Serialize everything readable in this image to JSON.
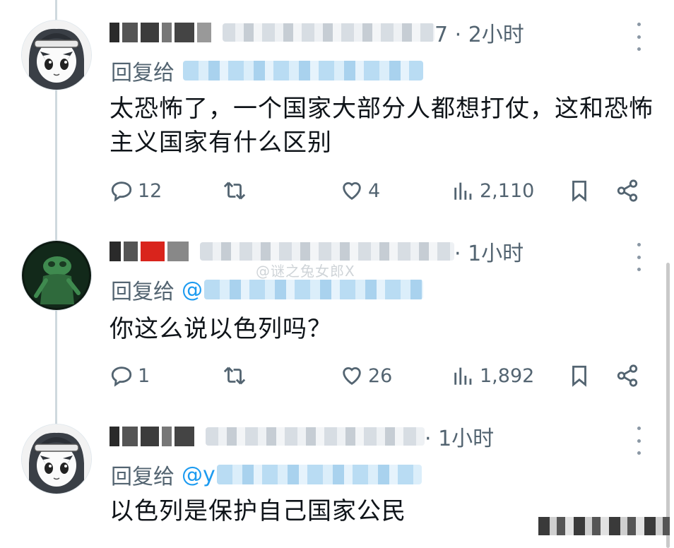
{
  "comments": [
    {
      "time": "7 · 2小时",
      "reply_label": "回复给",
      "reply_at": "",
      "text": "太恐怖了，一个国家大部分人都想打仗，这和恐怖主义国家有什么区别",
      "stats": {
        "replies": "12",
        "likes": "4",
        "views": "2,110"
      }
    },
    {
      "time": "· 1小时",
      "reply_label": "回复给",
      "reply_at": "@",
      "text": "你这么说以色列吗？",
      "stats": {
        "replies": "1",
        "likes": "26",
        "views": "1,892"
      }
    },
    {
      "time": "· 1小时",
      "reply_label": "回复给",
      "reply_at": "@y",
      "text": "以色列是保护自己国家公民"
    }
  ],
  "watermark": "@谜之兔女郎X",
  "icons": {
    "reply": "reply-icon",
    "retweet": "retweet-icon",
    "like": "heart-icon",
    "views": "views-icon",
    "bookmark": "bookmark-icon",
    "share": "share-icon",
    "more": "more-icon"
  },
  "colors": {
    "accent": "#1d9bf0",
    "muted": "#536471",
    "text": "#0f1419"
  }
}
